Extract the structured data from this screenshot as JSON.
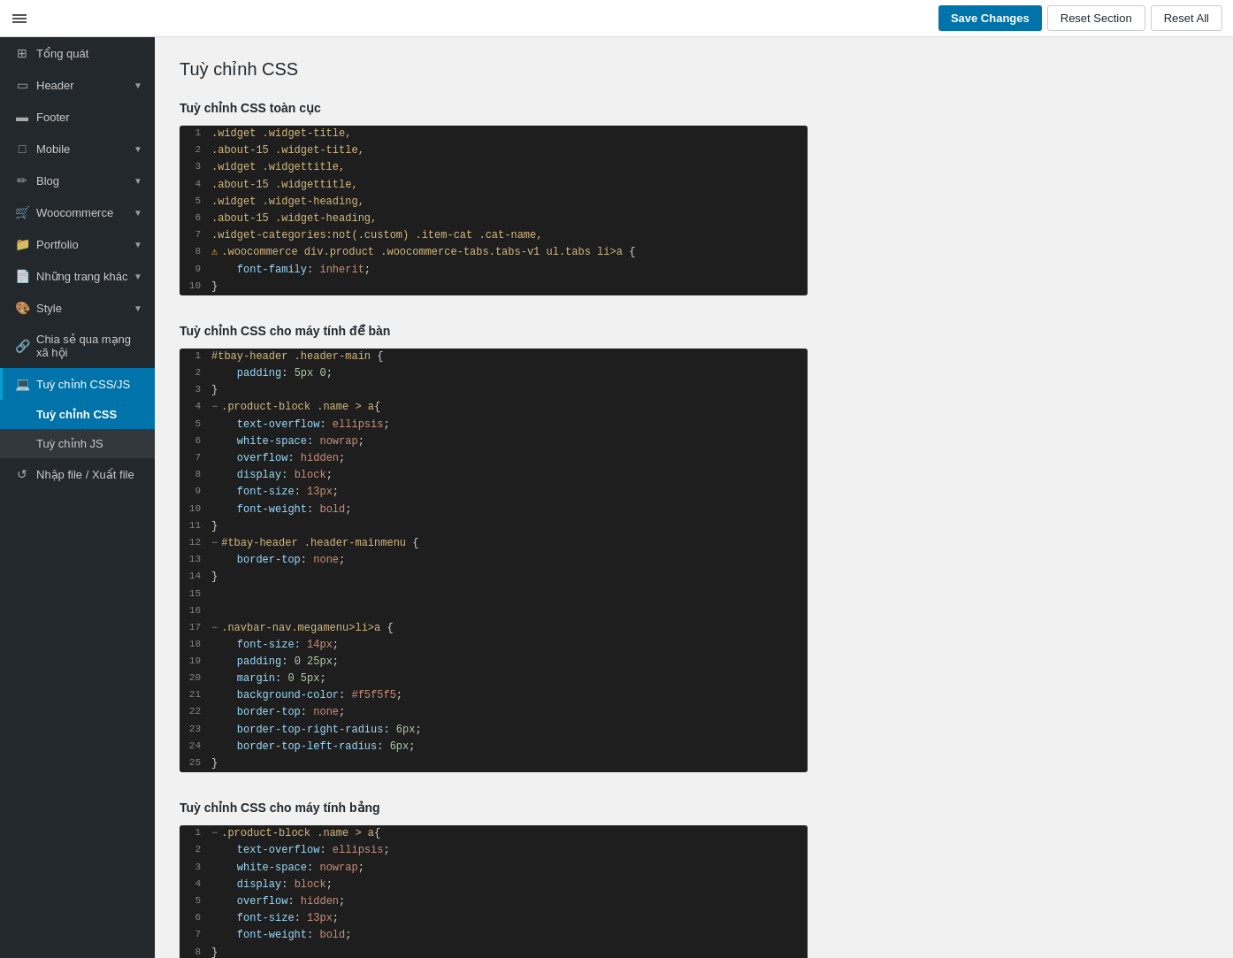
{
  "topbar": {
    "save_label": "Save Changes",
    "reset_section_label": "Reset Section",
    "reset_all_label": "Reset All"
  },
  "sidebar": {
    "items": [
      {
        "id": "tong-quat",
        "label": "Tổng quát",
        "icon": "⊞",
        "hasChildren": false,
        "active": false
      },
      {
        "id": "header",
        "label": "Header",
        "icon": "▭",
        "hasChildren": true,
        "active": false
      },
      {
        "id": "footer",
        "label": "Footer",
        "icon": "▬",
        "hasChildren": false,
        "active": false
      },
      {
        "id": "mobile",
        "label": "Mobile",
        "icon": "📱",
        "hasChildren": true,
        "active": false
      },
      {
        "id": "blog",
        "label": "Blog",
        "icon": "✏",
        "hasChildren": true,
        "active": false
      },
      {
        "id": "woocommerce",
        "label": "Woocommerce",
        "icon": "🛒",
        "hasChildren": true,
        "active": false
      },
      {
        "id": "portfolio",
        "label": "Portfolio",
        "icon": "📁",
        "hasChildren": true,
        "active": false
      },
      {
        "id": "nhung-trang-khac",
        "label": "Những trang khác",
        "icon": "📄",
        "hasChildren": true,
        "active": false
      },
      {
        "id": "style",
        "label": "Style",
        "icon": "🎨",
        "hasChildren": true,
        "active": false
      },
      {
        "id": "chia-se",
        "label": "Chia sẻ qua mạng xã hội",
        "icon": "🔗",
        "hasChildren": false,
        "active": false
      },
      {
        "id": "tuy-chinh-css-js",
        "label": "Tuỳ chỉnh CSS/JS",
        "icon": "💻",
        "hasChildren": false,
        "active": true,
        "children": [
          {
            "id": "tuy-chinh-css",
            "label": "Tuỳ chỉnh CSS",
            "active": true
          },
          {
            "id": "tuy-chinh-js",
            "label": "Tuỳ chỉnh JS",
            "active": false
          }
        ]
      },
      {
        "id": "nhap-xuat",
        "label": "Nhập file / Xuất file",
        "icon": "↺",
        "hasChildren": false,
        "active": false
      }
    ]
  },
  "main": {
    "page_title": "Tuỳ chỉnh CSS",
    "sections": [
      {
        "id": "toan-cuc",
        "title": "Tuỳ chỉnh CSS toàn cục"
      },
      {
        "id": "may-tinh-de-ban",
        "title": "Tuỳ chỉnh CSS cho máy tính để bàn"
      },
      {
        "id": "may-tinh-bang",
        "title": "Tuỳ chỉnh CSS cho máy tính bảng"
      }
    ]
  }
}
